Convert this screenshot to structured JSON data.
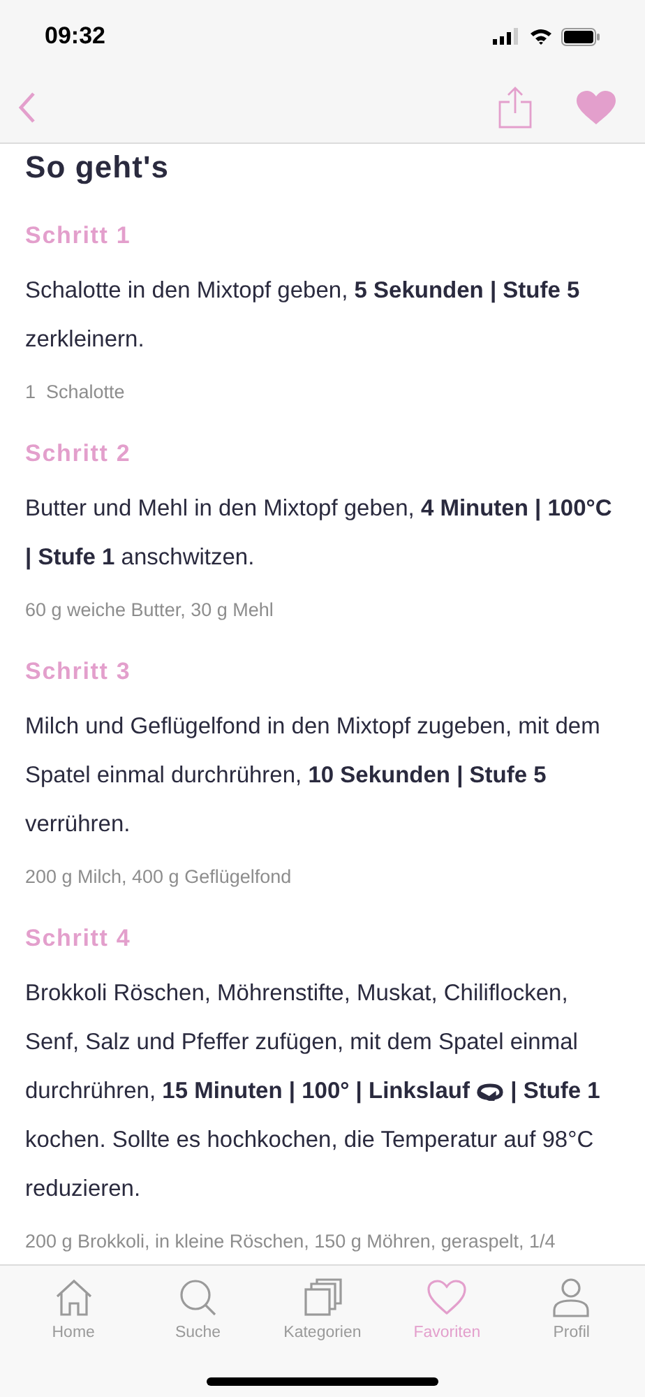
{
  "status_bar": {
    "time": "09:32"
  },
  "title": "So geht's",
  "steps": [
    {
      "heading": "Schritt 1",
      "text": "Schalotte in den Mixtopf geben, **5 Sekunden | Stufe 5** zerkleinern.",
      "ingredients": "1  Schalotte"
    },
    {
      "heading": "Schritt 2",
      "text": "Butter und Mehl in den Mixtopf geben, **4 Minuten | 100°C | Stufe 1** anschwitzen.",
      "ingredients": "60 g weiche Butter, 30 g Mehl"
    },
    {
      "heading": "Schritt 3",
      "text": "Milch und Geflügelfond in den Mixtopf zugeben, mit dem Spatel einmal durchrühren, **10 Sekunden | Stufe 5** verrühren.",
      "ingredients": "200 g Milch, 400 g Geflügelfond"
    },
    {
      "heading": "Schritt 4",
      "text": "Brokkoli Röschen, Möhrenstifte, Muskat, Chiliflocken, Senf, Salz und Pfeffer zufügen, mit dem Spatel einmal durchrühren, **15 Minuten | 100° | Linkslauf**",
      "text_after": "**| Stufe 1** kochen. Sollte es hochkochen, die Temperatur auf 98°C reduzieren.",
      "ingredients": "200 g Brokkoli, in kleine Röschen, 150 g Möhren, geraspelt, 1/4"
    }
  ],
  "tabs": [
    {
      "label": "Home",
      "selected": false
    },
    {
      "label": "Suche",
      "selected": false
    },
    {
      "label": "Kategorien",
      "selected": false
    },
    {
      "label": "Favoriten",
      "selected": true
    },
    {
      "label": "Profil",
      "selected": false
    }
  ]
}
